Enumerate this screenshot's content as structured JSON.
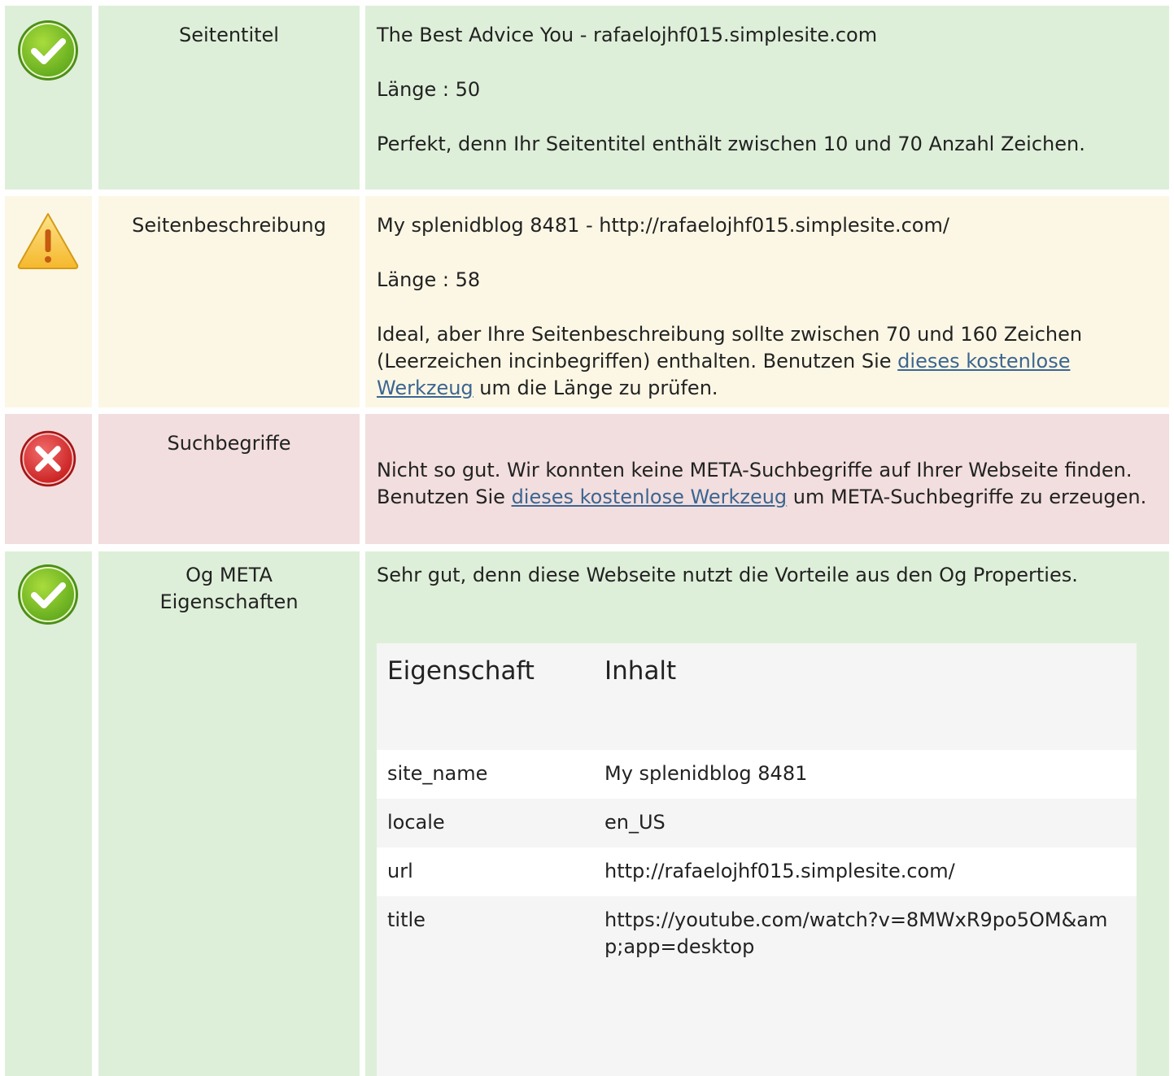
{
  "rows": [
    {
      "label": "Seitentitel",
      "status": "ok",
      "lines": [
        "The Best Advice You - rafaelojhf015.simplesite.com",
        "Länge : 50",
        "Perfekt, denn Ihr Seitentitel enthält zwischen 10 und 70 Anzahl Zeichen."
      ]
    },
    {
      "label": "Seitenbeschreibung",
      "status": "warning",
      "lines": [
        "My splenidblog 8481 - http://rafaelojhf015.simplesite.com/",
        "Länge : 58"
      ],
      "advice_before": "Ideal, aber Ihre Seitenbeschreibung sollte zwischen 70 und 160 Zeichen (Leerzeichen incinbegriffen) enthalten. Benutzen Sie ",
      "advice_link": "dieses kostenlose Werkzeug",
      "advice_after": " um die Länge zu prüfen."
    },
    {
      "label": "Suchbegriffe",
      "status": "error",
      "advice_before": "Nicht so gut. Wir konnten keine META-Suchbegriffe auf Ihrer Webseite finden. Benutzen Sie ",
      "advice_link": "dieses kostenlose Werkzeug",
      "advice_after": " um META-Suchbegriffe zu erzeugen."
    },
    {
      "label": "Og META Eigenschaften",
      "status": "ok",
      "intro": "Sehr gut, denn diese Webseite nutzt die Vorteile aus den Og Properties.",
      "table": {
        "headers": [
          "Eigenschaft",
          "Inhalt"
        ],
        "rows": [
          [
            "site_name",
            "My splenidblog 8481"
          ],
          [
            "locale",
            "en_US"
          ],
          [
            "url",
            "http://rafaelojhf015.simplesite.com/"
          ],
          [
            "title",
            "https://youtube.com/watch?v=8MWxR9po5OM&amp;app=desktop"
          ]
        ]
      }
    }
  ],
  "colors": {
    "ok_bg": "#deefd9",
    "warning_bg": "#fcf7e5",
    "error_bg": "#f2dede",
    "link": "#3c6591"
  },
  "icons": [
    "check-circle-icon",
    "warning-triangle-icon",
    "error-x-circle-icon"
  ]
}
